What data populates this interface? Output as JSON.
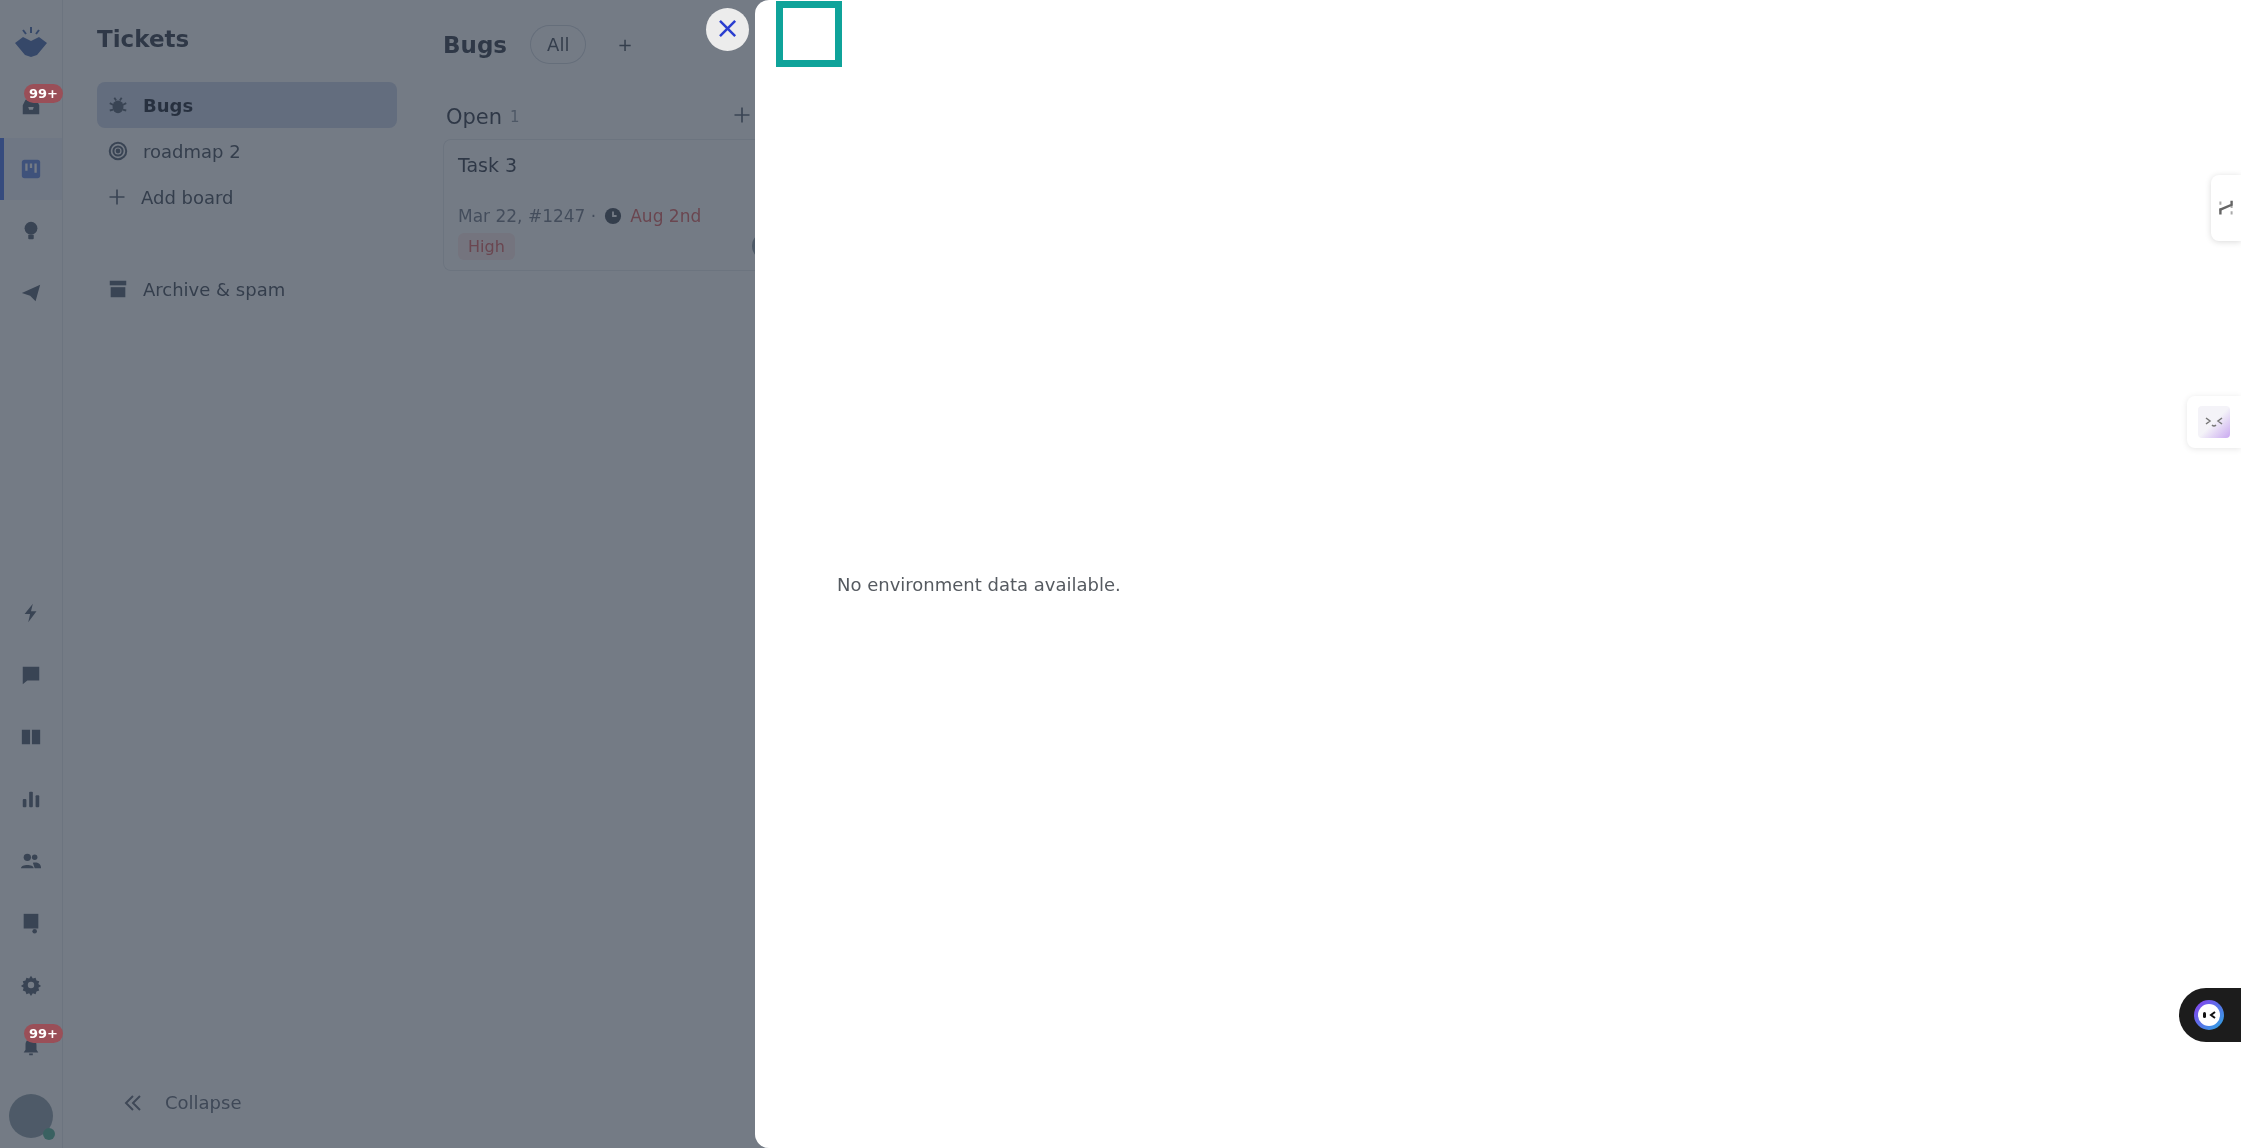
{
  "rail": {
    "items": [
      {
        "kind": "logo",
        "selected": false
      },
      {
        "kind": "inbox",
        "selected": false,
        "badge": "99+"
      },
      {
        "kind": "board",
        "selected": true
      },
      {
        "kind": "bulb",
        "selected": false
      },
      {
        "kind": "send",
        "selected": false
      },
      {
        "kind": "bolt",
        "selected": false
      },
      {
        "kind": "chat",
        "selected": false
      },
      {
        "kind": "book",
        "selected": false
      },
      {
        "kind": "chart",
        "selected": false
      },
      {
        "kind": "people",
        "selected": false
      },
      {
        "kind": "note",
        "selected": false
      },
      {
        "kind": "gear",
        "selected": false
      },
      {
        "kind": "bell",
        "selected": false,
        "badge": "99+"
      }
    ]
  },
  "sidebar": {
    "title": "Tickets",
    "items": [
      {
        "kind": "bug",
        "label": "Bugs",
        "selected": true
      },
      {
        "kind": "target",
        "label": "roadmap 2",
        "selected": false
      },
      {
        "kind": "add",
        "label": "Add board",
        "selected": false
      },
      {
        "kind": "archive",
        "label": "Archive & spam",
        "selected": false
      }
    ],
    "collapse": "Collapse"
  },
  "board": {
    "title": "Bugs",
    "tabs": [
      {
        "label": "All",
        "selected": true
      },
      {
        "label": "+",
        "selected": false
      }
    ],
    "columns": [
      {
        "name": "Open",
        "count": "1",
        "cards": [
          {
            "title": "Task 3",
            "meta": "Mar 22, #1247 ·",
            "due": "Aug 2nd",
            "tag": "High"
          }
        ]
      }
    ]
  },
  "drawer": {
    "close": "×",
    "message": "No environment data available."
  }
}
